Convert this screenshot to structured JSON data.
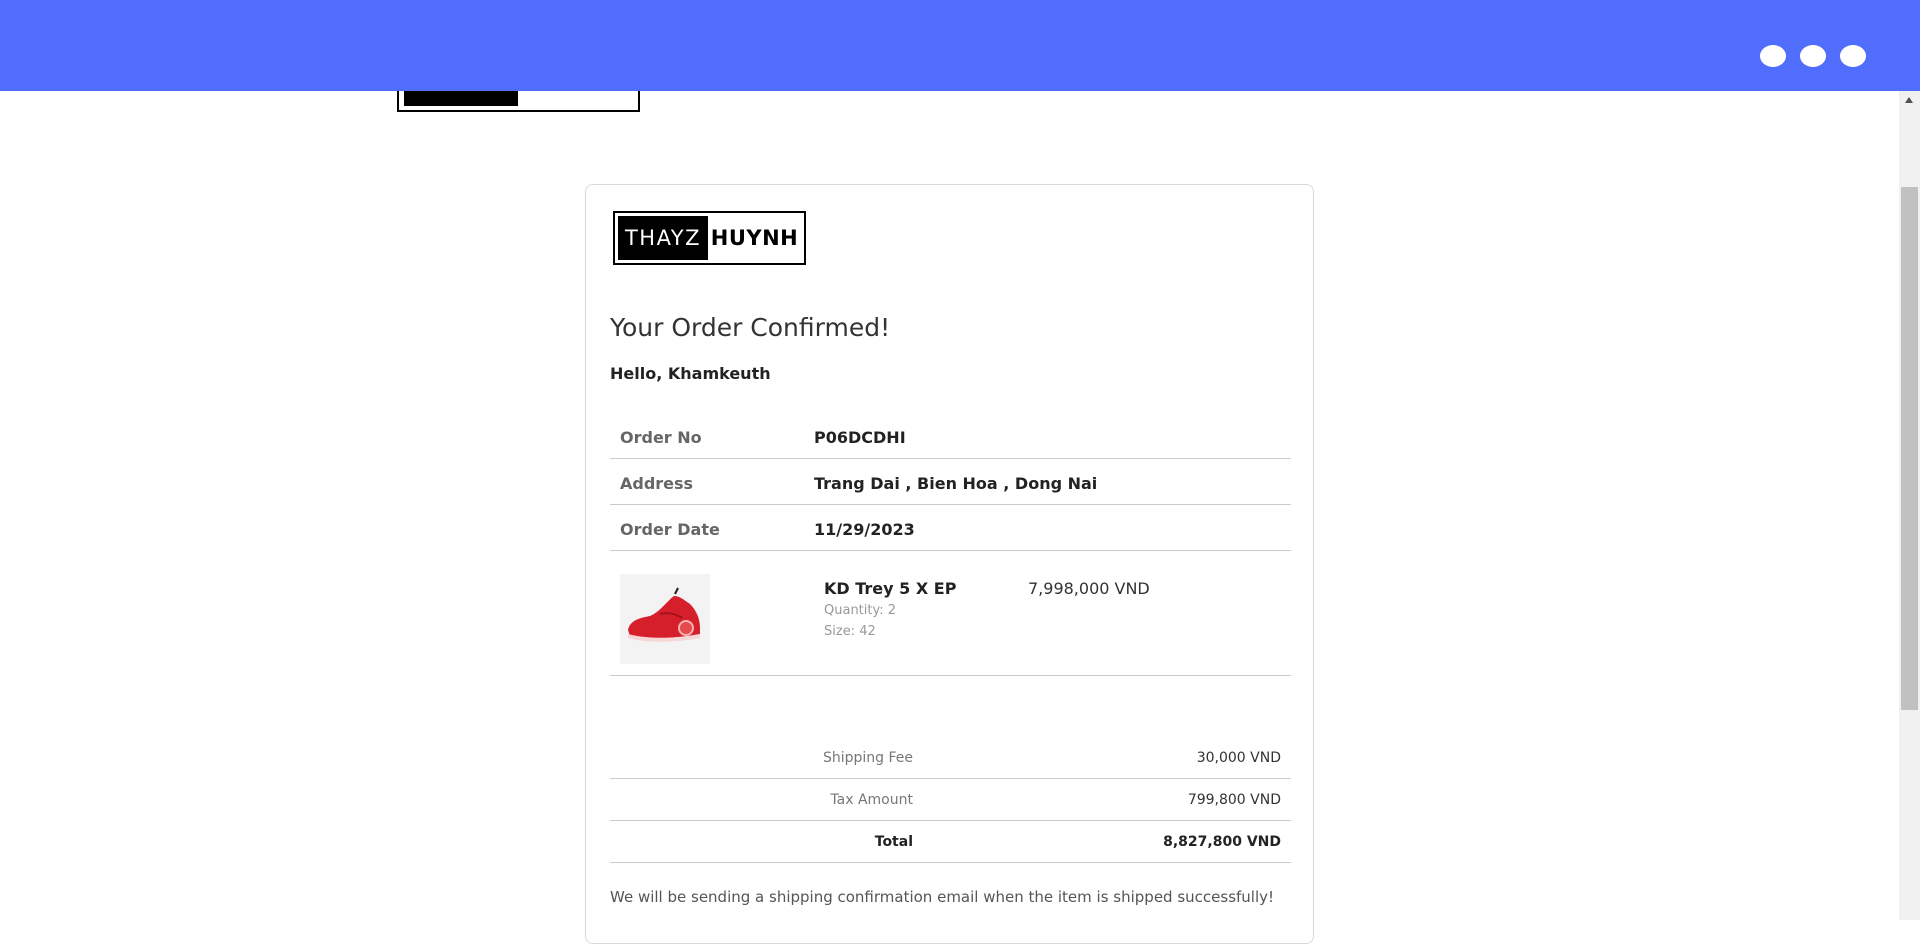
{
  "brand": {
    "part1": "THAYZ",
    "part2": "HUYNH"
  },
  "header": {
    "title": "Your Order Confirmed!",
    "greeting": "Hello, Khamkeuth"
  },
  "info": [
    {
      "label": "Order No",
      "value": "P06DCDHI"
    },
    {
      "label": "Address",
      "value": "Trang Dai , Bien Hoa , Dong Nai"
    },
    {
      "label": "Order Date",
      "value": "11/29/2023"
    }
  ],
  "item": {
    "name": "KD Trey 5 X EP",
    "quantity": "Quantity: 2",
    "size": "Size: 42",
    "price": "7,998,000 VND",
    "image_icon": "red-sneaker-image"
  },
  "totals": [
    {
      "label": "Shipping Fee",
      "value": "30,000 VND"
    },
    {
      "label": "Tax Amount",
      "value": "799,800 VND"
    },
    {
      "label": "Total",
      "value": "8,827,800 VND"
    }
  ],
  "note": "We will be sending a shipping confirmation email when the item is shipped successfully!",
  "colors": {
    "topbar": "#516dfd",
    "shoe": "#d5202c"
  }
}
